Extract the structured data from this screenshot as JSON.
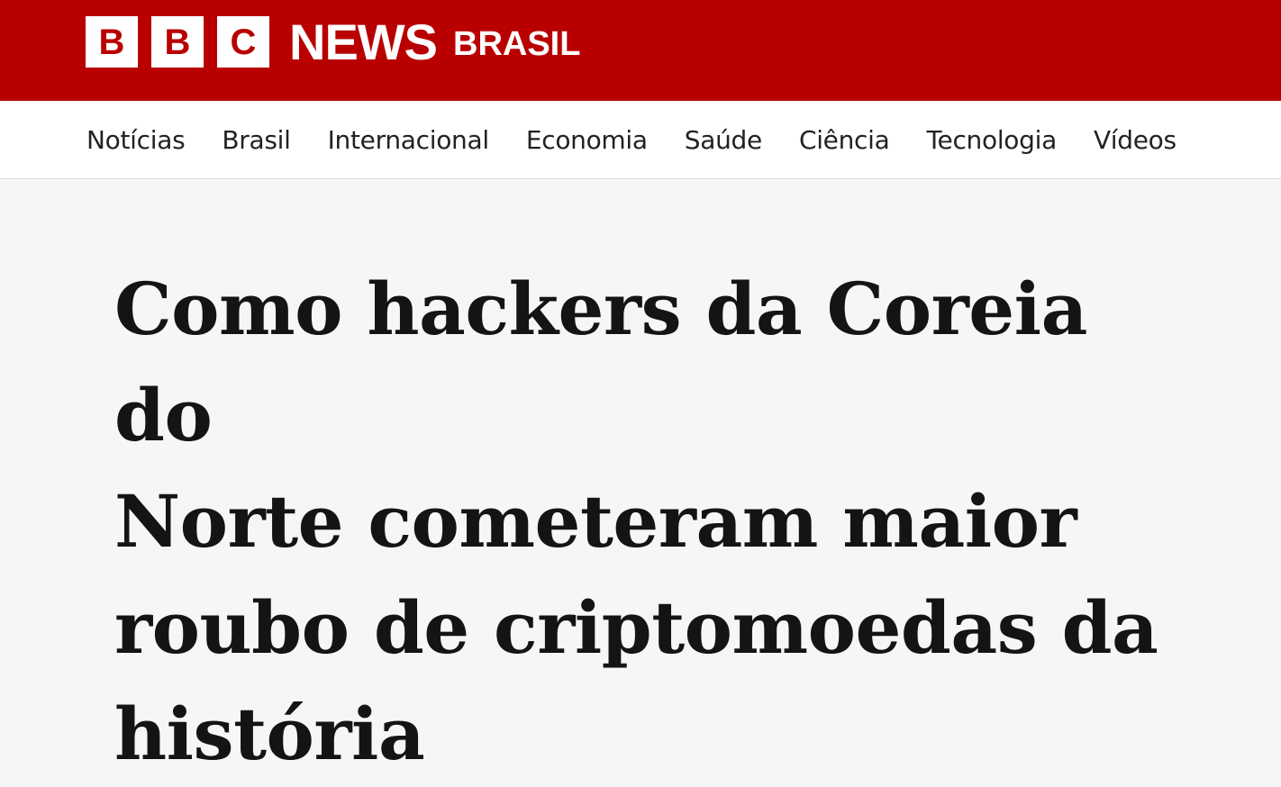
{
  "masthead": {
    "logo_letters": [
      "B",
      "B",
      "C"
    ],
    "logo_word": "NEWS",
    "edition": "BRASIL",
    "brand_color": "#b80000"
  },
  "nav": {
    "items": [
      {
        "label": "Notícias"
      },
      {
        "label": "Brasil"
      },
      {
        "label": "Internacional"
      },
      {
        "label": "Economia"
      },
      {
        "label": "Saúde"
      },
      {
        "label": "Ciência"
      },
      {
        "label": "Tecnologia"
      },
      {
        "label": "Vídeos"
      }
    ]
  },
  "article": {
    "headline_lines": [
      "Como hackers da Coreia do",
      "Norte cometeram maior",
      "roubo de criptomoedas da",
      "história"
    ]
  }
}
